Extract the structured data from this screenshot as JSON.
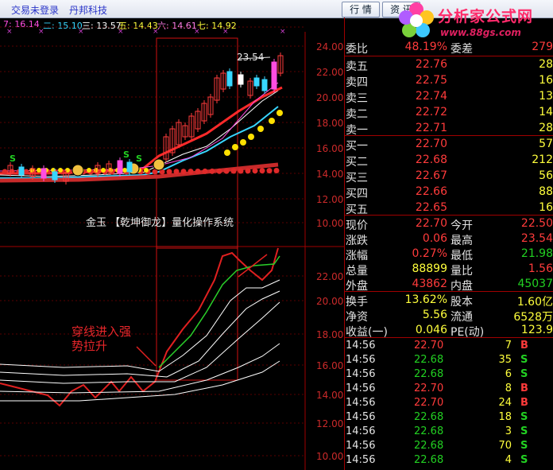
{
  "window": {
    "login_status": "交易未登录",
    "broker": "丹邦科技",
    "btn_quote": "行 情",
    "btn_info": "资 讯"
  },
  "watermark": {
    "brand": "分析家公式网",
    "url": "www.88gs.com"
  },
  "ma_legend": [
    {
      "label": "7: 16.14",
      "color": "#ff4de1"
    },
    {
      "label": "二: 15.10",
      "color": "#38d6ff"
    },
    {
      "label": "三: 13.57",
      "color": "#ffffff"
    },
    {
      "label": "五: 14.43",
      "color": "#ffff3c"
    },
    {
      "label": "六: 14.61",
      "color": "#ff7ee8"
    },
    {
      "label": "七: 14.92",
      "color": "#ffff3c"
    }
  ],
  "price_axis_top": [
    "24.00",
    "22.00",
    "20.00",
    "18.00",
    "16.00",
    "14.00",
    "12.00",
    "10.00"
  ],
  "price_axis_bottom": [
    "22.00",
    "20.00",
    "18.00",
    "16.00",
    "14.00",
    "12.00",
    "10.00"
  ],
  "price_label": "23.54",
  "panel_title": "金玉 【乾坤御龙】量化操作系统",
  "annotation": [
    "穿线进入强",
    "势拉升"
  ],
  "signal_letter": "S",
  "order_book": {
    "weibi_label": "委比",
    "weibi_value": "48.19%",
    "weicha_label": "委差",
    "weicha_value": "279",
    "sells": [
      {
        "label": "卖五",
        "price": "22.76",
        "vol": "28"
      },
      {
        "label": "卖四",
        "price": "22.75",
        "vol": "16"
      },
      {
        "label": "卖三",
        "price": "22.74",
        "vol": "13"
      },
      {
        "label": "卖二",
        "price": "22.72",
        "vol": "14"
      },
      {
        "label": "卖一",
        "price": "22.71",
        "vol": "28"
      }
    ],
    "buys": [
      {
        "label": "买一",
        "price": "22.70",
        "vol": "57"
      },
      {
        "label": "买二",
        "price": "22.68",
        "vol": "212"
      },
      {
        "label": "买三",
        "price": "22.67",
        "vol": "56"
      },
      {
        "label": "买四",
        "price": "22.66",
        "vol": "88"
      },
      {
        "label": "买五",
        "price": "22.65",
        "vol": "16"
      }
    ]
  },
  "stats": [
    {
      "l": "现价",
      "v": "22.70",
      "vc": "#ff3b3b",
      "l2": "今开",
      "v2": "22.50",
      "v2c": "#ff3b3b"
    },
    {
      "l": "涨跌",
      "v": "0.06",
      "vc": "#ff3b3b",
      "l2": "最高",
      "v2": "23.54",
      "v2c": "#ff3b3b"
    },
    {
      "l": "涨幅",
      "v": "0.27%",
      "vc": "#ff3b3b",
      "l2": "最低",
      "v2": "21.98",
      "v2c": "#22d022"
    },
    {
      "l": "总量",
      "v": "88899",
      "vc": "#ffff3c",
      "l2": "量比",
      "v2": "1.56",
      "v2c": "#ff3b3b"
    },
    {
      "l": "外盘",
      "v": "43862",
      "vc": "#ff3b3b",
      "l2": "内盘",
      "v2": "45037",
      "v2c": "#22d022"
    }
  ],
  "stats2": [
    {
      "l": "换手",
      "v": "13.62%",
      "vc": "#ffff3c",
      "l2": "股本",
      "v2": "1.60亿",
      "v2c": "#ffff3c"
    },
    {
      "l": "净资",
      "v": "5.56",
      "vc": "#ffff3c",
      "l2": "流通",
      "v2": "6528万",
      "v2c": "#ffff3c"
    },
    {
      "l": "收益(一)",
      "v": "0.046",
      "vc": "#ffff3c",
      "l2": "PE(动)",
      "v2": "123.9",
      "v2c": "#ffff3c"
    }
  ],
  "ticks": [
    {
      "t": "14:56",
      "p": "22.70",
      "v": "7",
      "s": "B"
    },
    {
      "t": "14:56",
      "p": "22.68",
      "v": "35",
      "s": "S"
    },
    {
      "t": "14:56",
      "p": "22.68",
      "v": "6",
      "s": "S"
    },
    {
      "t": "14:56",
      "p": "22.70",
      "v": "8",
      "s": "B"
    },
    {
      "t": "14:56",
      "p": "22.70",
      "v": "24",
      "s": "B"
    },
    {
      "t": "14:56",
      "p": "22.68",
      "v": "18",
      "s": "S"
    },
    {
      "t": "14:56",
      "p": "22.68",
      "v": "3",
      "s": "S"
    },
    {
      "t": "14:56",
      "p": "22.68",
      "v": "70",
      "s": "S"
    },
    {
      "t": "14:56",
      "p": "22.68",
      "v": "4",
      "s": "S"
    }
  ]
}
